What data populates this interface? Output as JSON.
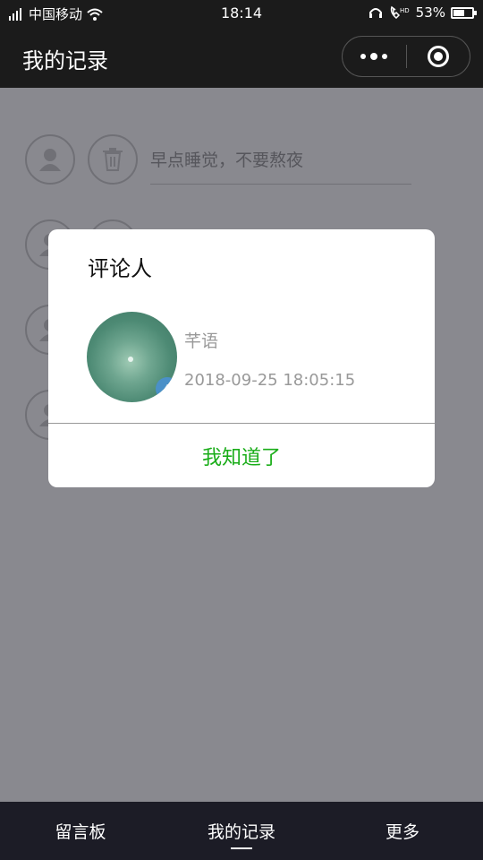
{
  "status_bar": {
    "carrier": "中国移动",
    "time": "18:14",
    "battery": "53%",
    "battery_level": 0.53,
    "icons": [
      "signal-icon",
      "wifi-icon",
      "headset-icon",
      "hd-call-icon",
      "battery-icon"
    ]
  },
  "nav": {
    "title": "我的记录"
  },
  "rows": [
    {
      "text": "早点睡觉，不要熬夜"
    },
    {
      "text": ""
    },
    {
      "text": ""
    },
    {
      "text": ""
    }
  ],
  "modal": {
    "title": "评论人",
    "name": "芊语",
    "time": "2018-09-25 18:05:15",
    "confirm_label": "我知道了",
    "confirm_color": "#1aad19"
  },
  "tabs": [
    {
      "label": "留言板"
    },
    {
      "label": "我的记录",
      "active": true
    },
    {
      "label": "更多"
    }
  ]
}
